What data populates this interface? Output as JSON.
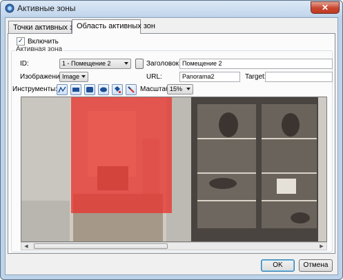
{
  "window": {
    "title": "Активные зоны",
    "close_glyph": "✕",
    "icon": "app-icon"
  },
  "tabs": [
    {
      "label": "Точки активных зон",
      "active": false
    },
    {
      "label": "Область активных зон",
      "active": true
    }
  ],
  "enable": {
    "label": "Включить",
    "checked": true,
    "check_glyph": "✓"
  },
  "zone_group": {
    "title": "Активная зона",
    "id_label": "ID:",
    "id_value": "1 - Помещение 2",
    "header_label": "Заголовок:",
    "header_value": "Помещение 2",
    "image_label": "Изображение:",
    "image_value": "Image",
    "url_label": "URL:",
    "url_value": "Panorama2",
    "target_label": "Target:",
    "target_value": "",
    "tools_label": "Инструменты:",
    "tools": [
      "polyline-tool-icon",
      "rectangle-tool-icon",
      "rounded-rectangle-tool-icon",
      "ellipse-tool-icon",
      "fill-tool-icon",
      "eraser-tool-icon"
    ],
    "scale_label": "Масштаб:",
    "scale_value": "15%"
  },
  "viewer": {
    "zone_overlay_color": "#e8352e"
  },
  "buttons": {
    "ok": "OK",
    "cancel": "Отмена"
  },
  "colors": {
    "accent": "#3c7fb1",
    "title_bar": "#c2d6ec"
  }
}
